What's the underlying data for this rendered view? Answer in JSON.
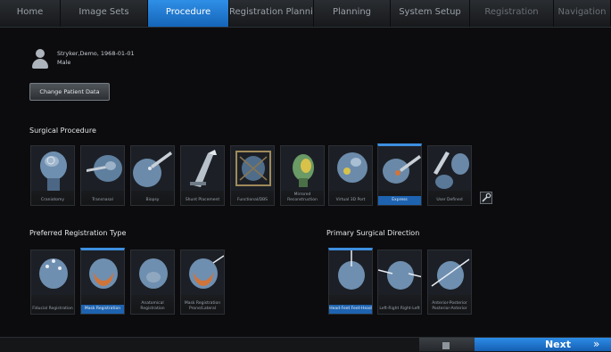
{
  "tabs": [
    {
      "label": "Home",
      "state": "normal"
    },
    {
      "label": "Image Sets",
      "state": "normal"
    },
    {
      "label": "Procedure",
      "state": "active"
    },
    {
      "label": "Registration Planning",
      "state": "normal"
    },
    {
      "label": "Planning",
      "state": "normal"
    },
    {
      "label": "System Setup",
      "state": "normal"
    },
    {
      "label": "Registration",
      "state": "disabled"
    },
    {
      "label": "Navigation",
      "state": "disabled"
    }
  ],
  "patient": {
    "name": "Stryker,Demo, 1968-01-01",
    "sex": "Male",
    "icon": "person-icon"
  },
  "buttons": {
    "change_patient": "Change Patient Data",
    "next": "Next",
    "next_icon": "double-chevron-right-icon"
  },
  "sections": {
    "surgical_procedure": "Surgical Procedure",
    "registration_type": "Preferred Registration Type",
    "surgical_direction": "Primary Surgical Direction"
  },
  "procedures": [
    {
      "label": "Craniotomy",
      "selected": false
    },
    {
      "label": "Transnasal",
      "selected": false
    },
    {
      "label": "Biopsy",
      "selected": false
    },
    {
      "label": "Shunt Placement",
      "selected": false
    },
    {
      "label": "Functional/DBS",
      "selected": false
    },
    {
      "label": "Mirrored Reconstruction",
      "selected": false
    },
    {
      "label": "Virtual 3D Port",
      "selected": false
    },
    {
      "label": "Express",
      "selected": true
    },
    {
      "label": "User Defined",
      "selected": false
    }
  ],
  "registration_types": [
    {
      "label": "Fiducial Registration",
      "selected": false
    },
    {
      "label": "Mask Registration",
      "selected": true
    },
    {
      "label": "Anatomical Registration",
      "selected": false
    },
    {
      "label": "Mask Registration Prone/Lateral",
      "selected": false
    }
  ],
  "directions": [
    {
      "label": "Head-Feet Feet-Head",
      "selected": true
    },
    {
      "label": "Left-Right Right-Left",
      "selected": false
    },
    {
      "label": "Anterior-Posterior Posterior-Anterior",
      "selected": false
    }
  ],
  "colors": {
    "accent": "#2f8fe6",
    "background": "#0c0c0e"
  }
}
